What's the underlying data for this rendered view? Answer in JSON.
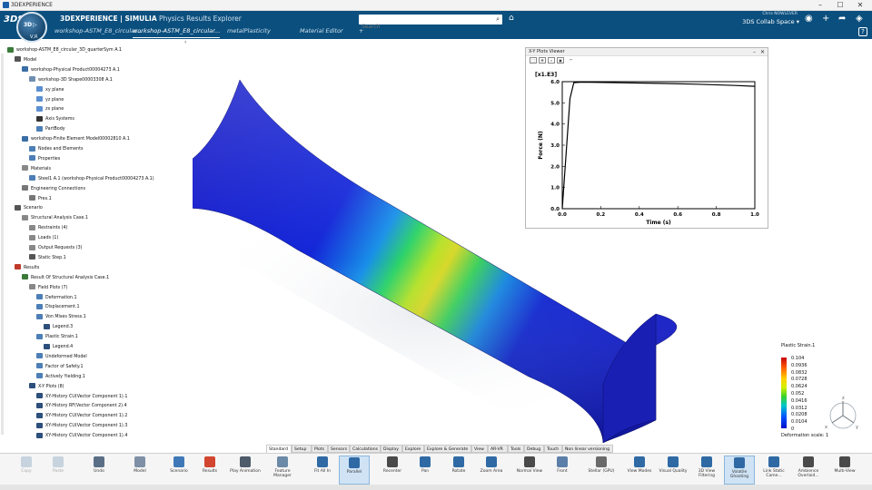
{
  "window": {
    "title": "3DEXPERIENCE"
  },
  "header": {
    "brand": "3DEXPERIENCE | SIMULIA",
    "app": "Physics Results Explorer",
    "compass_version": "V,R",
    "search_placeholder": "Search",
    "user": "Chris NOWLEVER",
    "collab_space": "3DS Collab Space",
    "tabs": [
      {
        "label": "workshop-ASTM_E8_circular..."
      },
      {
        "label": "workshop-ASTM_E8_circular..."
      },
      {
        "label": "metalPlasticity"
      },
      {
        "label": "Material Editor"
      },
      {
        "label": "+"
      }
    ]
  },
  "tree": {
    "items": [
      {
        "label": "workshop-ASTM_E8_circular_3D_quarterSym A.1",
        "indent": 0,
        "color": "#3a7a3a"
      },
      {
        "label": "Model",
        "indent": 1,
        "color": "#555"
      },
      {
        "label": "workshop-Physical Product00004273 A.1",
        "indent": 2,
        "color": "#3a6ea5"
      },
      {
        "label": "workshop-3D Shape00003308 A.1",
        "indent": 3,
        "color": "#6f8fb0"
      },
      {
        "label": "xy plane",
        "indent": 4,
        "color": "#5b8fd1"
      },
      {
        "label": "yz plane",
        "indent": 4,
        "color": "#5b8fd1"
      },
      {
        "label": "zx plane",
        "indent": 4,
        "color": "#5b8fd1"
      },
      {
        "label": "Axis Systems",
        "indent": 4,
        "color": "#333"
      },
      {
        "label": "PartBody",
        "indent": 4,
        "color": "#4d7fb6"
      },
      {
        "label": "workshop-Finite Element Model00002810 A.1",
        "indent": 2,
        "color": "#3a6ea5"
      },
      {
        "label": "Nodes and Elements",
        "indent": 3,
        "color": "#4d7fb6"
      },
      {
        "label": "Properties",
        "indent": 3,
        "color": "#4d7fb6"
      },
      {
        "label": "Materials",
        "indent": 2,
        "color": "#888"
      },
      {
        "label": "Steel1 A.1 (workshop-Physical Product00004273 A.1)",
        "indent": 3,
        "color": "#4d7fb6"
      },
      {
        "label": "Engineering Connections",
        "indent": 2,
        "color": "#777"
      },
      {
        "label": "Pres.1",
        "indent": 3,
        "color": "#777"
      },
      {
        "label": "Scenario",
        "indent": 1,
        "color": "#555"
      },
      {
        "label": "Structural Analysis Case.1",
        "indent": 2,
        "color": "#888"
      },
      {
        "label": "Restraints (4)",
        "indent": 3,
        "color": "#888"
      },
      {
        "label": "Loads (1)",
        "indent": 3,
        "color": "#888"
      },
      {
        "label": "Output Requests (3)",
        "indent": 3,
        "color": "#888"
      },
      {
        "label": "Static Step.1",
        "indent": 3,
        "color": "#555"
      },
      {
        "label": "Results",
        "indent": 1,
        "color": "#c0392b"
      },
      {
        "label": "Result Of Structural Analysis Case.1",
        "indent": 2,
        "color": "#3a7a3a"
      },
      {
        "label": "Field Plots (7)",
        "indent": 3,
        "color": "#888"
      },
      {
        "label": "Deformation.1",
        "indent": 4,
        "color": "#4d7fb6"
      },
      {
        "label": "Displacement.1",
        "indent": 4,
        "color": "#4d7fb6"
      },
      {
        "label": "Von Mises Stress.1",
        "indent": 4,
        "color": "#4d7fb6"
      },
      {
        "label": "Legend.3",
        "indent": 5,
        "color": "#2c4f7c"
      },
      {
        "label": "Plastic Strain.1",
        "indent": 4,
        "color": "#4d7fb6"
      },
      {
        "label": "Legend.4",
        "indent": 5,
        "color": "#2c4f7c"
      },
      {
        "label": "Undeformed Model",
        "indent": 4,
        "color": "#4d7fb6"
      },
      {
        "label": "Factor of Safety.1",
        "indent": 4,
        "color": "#4d7fb6"
      },
      {
        "label": "Actively Yielding.1",
        "indent": 4,
        "color": "#4d7fb6"
      },
      {
        "label": "X-Y Plots (8)",
        "indent": 3,
        "color": "#2c4f7c"
      },
      {
        "label": "XY-History CU(Vector Component 1).1",
        "indent": 4,
        "color": "#2c4f7c"
      },
      {
        "label": "XY-History RF(Vector Component 2).4",
        "indent": 4,
        "color": "#2c4f7c"
      },
      {
        "label": "XY-History CU(Vector Component 1).2",
        "indent": 4,
        "color": "#2c4f7c"
      },
      {
        "label": "XY-History CU(Vector Component 1).3",
        "indent": 4,
        "color": "#2c4f7c"
      },
      {
        "label": "XY-History CU(Vector Component 1).4",
        "indent": 4,
        "color": "#2c4f7c"
      }
    ]
  },
  "xy_viewer": {
    "title": "X-Y Plots Viewer"
  },
  "chart_data": {
    "type": "line",
    "title": "",
    "multiplier": "[x1.E3]",
    "xlabel": "Time (s)",
    "ylabel": "Force (N)",
    "xlim": [
      0.0,
      1.0
    ],
    "ylim": [
      0.0,
      6.0
    ],
    "x_ticks": [
      "0.0",
      "0.2",
      "0.4",
      "0.6",
      "0.8",
      "1.0"
    ],
    "y_ticks": [
      "0.0",
      "1.0",
      "2.0",
      "3.0",
      "4.0",
      "5.0",
      "6.0"
    ],
    "series": [
      {
        "x": [
          0.0,
          0.04,
          0.06,
          0.1,
          0.3,
          0.5,
          0.7,
          0.9,
          1.0
        ],
        "y": [
          0.0,
          5.2,
          5.95,
          5.98,
          5.95,
          5.92,
          5.88,
          5.82,
          5.78
        ],
        "color": "#000000"
      }
    ]
  },
  "legend": {
    "title": "Plastic Strain.1",
    "values": [
      "0.104",
      "0.0936",
      "0.0832",
      "0.0728",
      "0.0624",
      "0.052",
      "0.0416",
      "0.0312",
      "0.0208",
      "0.0104",
      "0"
    ],
    "scale_label": "Deformation scale: 1"
  },
  "command_tabs": [
    "Standard",
    "Setup",
    "Plots",
    "Sensors",
    "Calculations",
    "Display",
    "Explore",
    "Explore & Generate",
    "View",
    "AR-VR",
    "Tools",
    "Debug",
    "Touch",
    "Non linear versioning"
  ],
  "actions": [
    {
      "label": "Copy",
      "color": "#c7d3de",
      "disabled": true
    },
    {
      "label": "Paste",
      "color": "#c7d3de",
      "disabled": true
    },
    {
      "label": "Undo",
      "color": "#5a6f86",
      "disabled": false
    },
    {
      "label": "Model",
      "color": "#7f8fa6",
      "disabled": false
    },
    {
      "label": "Scenario",
      "color": "#3f78b8",
      "disabled": false
    },
    {
      "label": "Results",
      "color": "#d2452f",
      "disabled": false
    },
    {
      "label": "Play Animation",
      "color": "#4d5b6a",
      "disabled": false
    },
    {
      "label": "Feature Manager",
      "color": "#6c8aa8",
      "disabled": false
    },
    {
      "label": "Fit All In",
      "color": "#2f6aa4",
      "disabled": false
    },
    {
      "label": "Parallel",
      "color": "#2f6aa4",
      "disabled": false,
      "selected": true
    },
    {
      "label": "Recenter",
      "color": "#4a4a4a",
      "disabled": false
    },
    {
      "label": "Pan",
      "color": "#2f6aa4",
      "disabled": false
    },
    {
      "label": "Rotate",
      "color": "#2f6aa4",
      "disabled": false
    },
    {
      "label": "Zoom Area",
      "color": "#2f6aa4",
      "disabled": false
    },
    {
      "label": "Normal View",
      "color": "#4a4a4a",
      "disabled": false
    },
    {
      "label": "Front",
      "color": "#5b7fa8",
      "disabled": false
    },
    {
      "label": "Stellar (GPU)",
      "color": "#6a6a6a",
      "disabled": false
    },
    {
      "label": "View Modes",
      "color": "#2f6aa4",
      "disabled": false
    },
    {
      "label": "Visual Quality",
      "color": "#2f6aa4",
      "disabled": false
    },
    {
      "label": "3D View Filtering",
      "color": "#2f6aa4",
      "disabled": false
    },
    {
      "label": "Volatile Ghosting",
      "color": "#2f6aa4",
      "disabled": false,
      "selected": true
    },
    {
      "label": "Link Static Came...",
      "color": "#2f6aa4",
      "disabled": false
    },
    {
      "label": "Ambience Overlaid...",
      "color": "#4a4a4a",
      "disabled": false
    },
    {
      "label": "Multi-View",
      "color": "#4a4a4a",
      "disabled": false
    }
  ]
}
